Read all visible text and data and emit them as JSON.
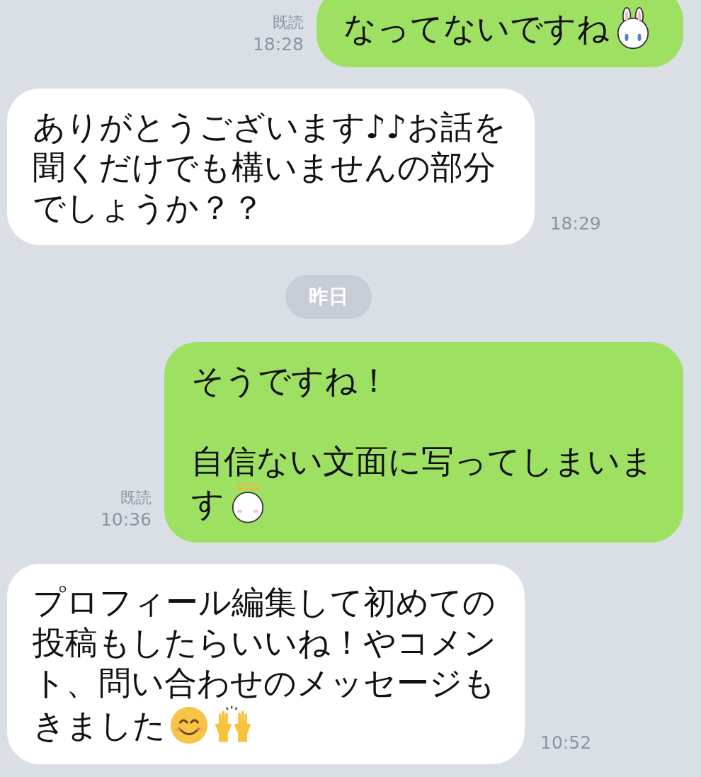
{
  "messages": [
    {
      "kind": "sent",
      "read": "既読",
      "time": "18:28",
      "paragraphs": [
        [
          "なってないですね"
        ]
      ],
      "stickers": [
        {
          "kind": "rabbit"
        }
      ]
    },
    {
      "kind": "received",
      "time": "18:29",
      "paragraphs": [
        [
          "ありがとうございます♪♪お話を",
          "聞くだけでも構いませんの部分",
          "でしょうか？？"
        ]
      ]
    },
    {
      "kind": "date",
      "label": "昨日"
    },
    {
      "kind": "sent",
      "read": "既読",
      "time": "10:36",
      "paragraphs": [
        [
          "そうですね！"
        ],
        [
          "自信ない文面に写ってしまいま",
          "す"
        ]
      ],
      "stickers": [
        {
          "kind": "halo"
        }
      ]
    },
    {
      "kind": "received",
      "time": "10:52",
      "paragraphs": [
        [
          "プロフィール編集して初めての",
          "投稿もしたらいいね！やコメン",
          "ト、問い合わせのメッセージも",
          "きました"
        ]
      ],
      "stickers": [
        {
          "kind": "smiley"
        },
        {
          "kind": "hands"
        }
      ]
    }
  ]
}
